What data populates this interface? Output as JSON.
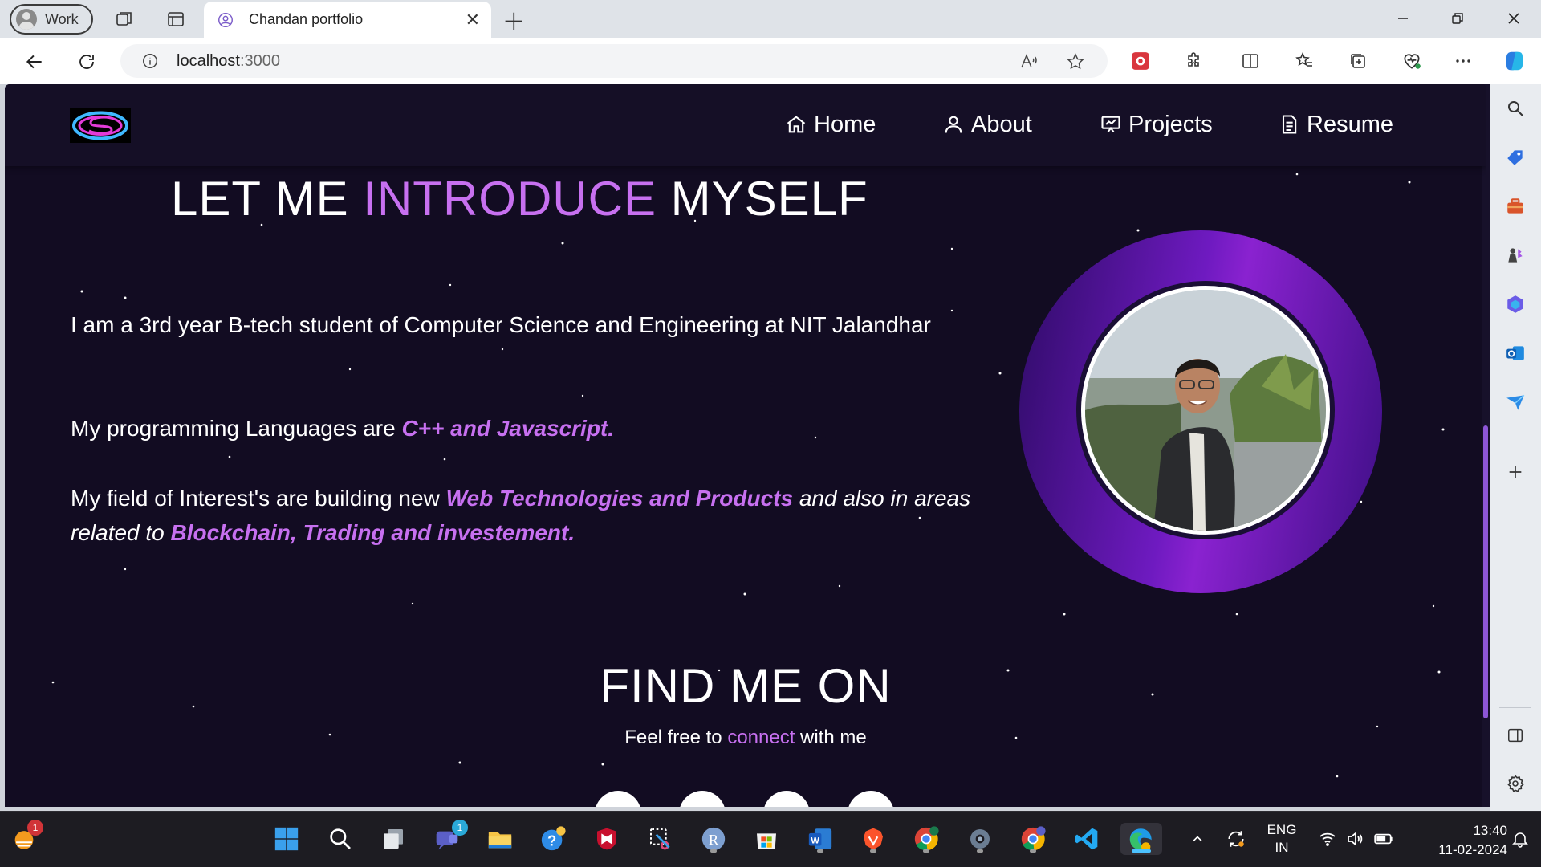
{
  "browser": {
    "profile_label": "Work",
    "tab_title": "Chandan portfolio",
    "url_host": "localhost",
    "url_port": ":3000"
  },
  "site": {
    "menu": [
      {
        "label": "Home",
        "icon": "home-icon"
      },
      {
        "label": "About",
        "icon": "user-icon"
      },
      {
        "label": "Projects",
        "icon": "presentation-icon"
      },
      {
        "label": "Resume",
        "icon": "document-icon"
      }
    ],
    "intro": {
      "title_start": "LET ME ",
      "title_accent": "INTRODUCE",
      "title_end": " MYSELF",
      "p1": "I am a 3rd year B-tech student of Computer Science and Engineering at NIT Jalandhar",
      "p2_start": "My programming Languages are ",
      "p2_accent": "C++ and Javascript.",
      "p3_start": "My field of Interest's are building new ",
      "p3_accent1": "Web Technologies and Products",
      "p3_mid": " and also in areas related to ",
      "p3_accent2": "Blockchain, Trading and investement."
    },
    "find": {
      "title": "FIND ME ON",
      "sub_start": "Feel free to ",
      "sub_accent": "connect",
      "sub_end": " with me"
    },
    "accent_color": "#c770f0",
    "background_color": "#120c22"
  },
  "taskbar": {
    "notification_badge": "1",
    "teams_badge": "1",
    "lang_top": "ENG",
    "lang_bottom": "IN",
    "time": "13:40",
    "date": "11-02-2024"
  }
}
